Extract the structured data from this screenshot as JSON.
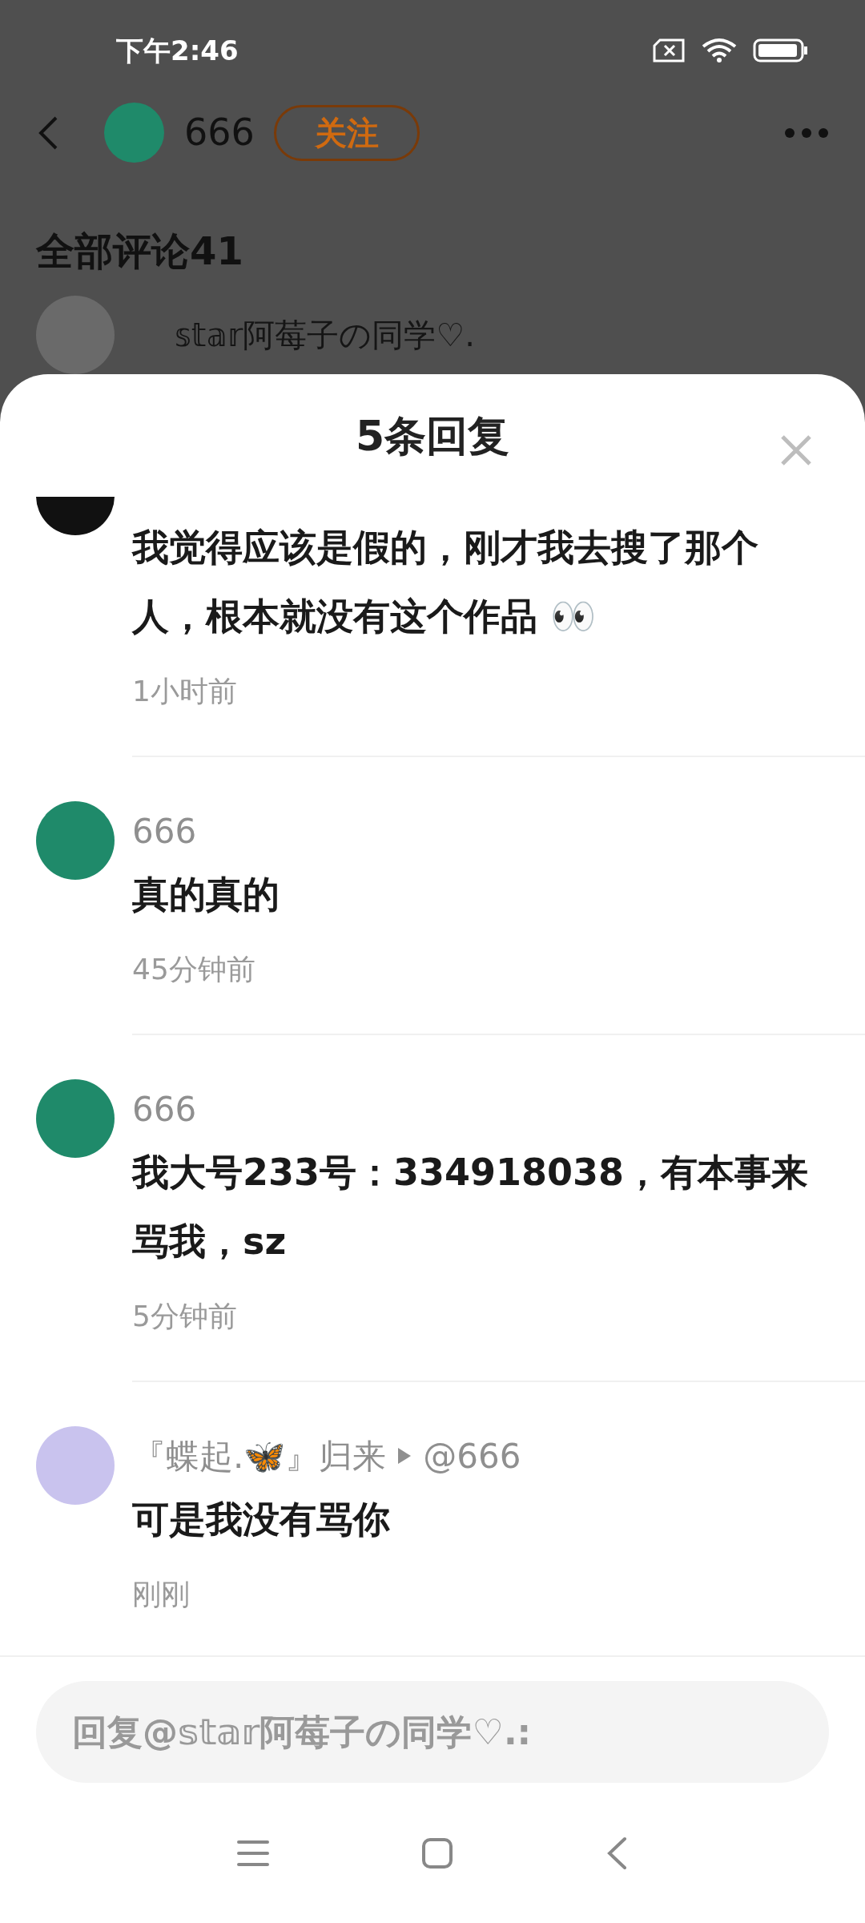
{
  "status_bar": {
    "time": "下午2:46"
  },
  "header": {
    "author": "666",
    "follow_label": "关注"
  },
  "comments_title": "全部评论41",
  "background_comment": {
    "name": "𝕤𝕥𝕒𝕣阿莓子の同学♡."
  },
  "sheet": {
    "title": "5条回复",
    "replies": [
      {
        "color": "#111111",
        "content": "我觉得应该是假的，刚才我去搜了那个人，根本就没有这个作品 👀",
        "time": "1小时前"
      },
      {
        "color": "#1f8a6a",
        "name": "666",
        "content": "真的真的",
        "time": "45分钟前"
      },
      {
        "color": "#1f8a6a",
        "name": "666",
        "content": "我大号233号：334918038，有本事来骂我，sz",
        "time": "5分钟前"
      },
      {
        "color": "#c9c3ee",
        "name": "『蝶起.🦋』归来",
        "reply_to": "@666",
        "content": "可是我没有骂你",
        "time": "刚刚"
      }
    ]
  },
  "reply_field": {
    "placeholder": "回复@𝕤𝕥𝕒𝕣阿莓子の同学♡.:"
  }
}
